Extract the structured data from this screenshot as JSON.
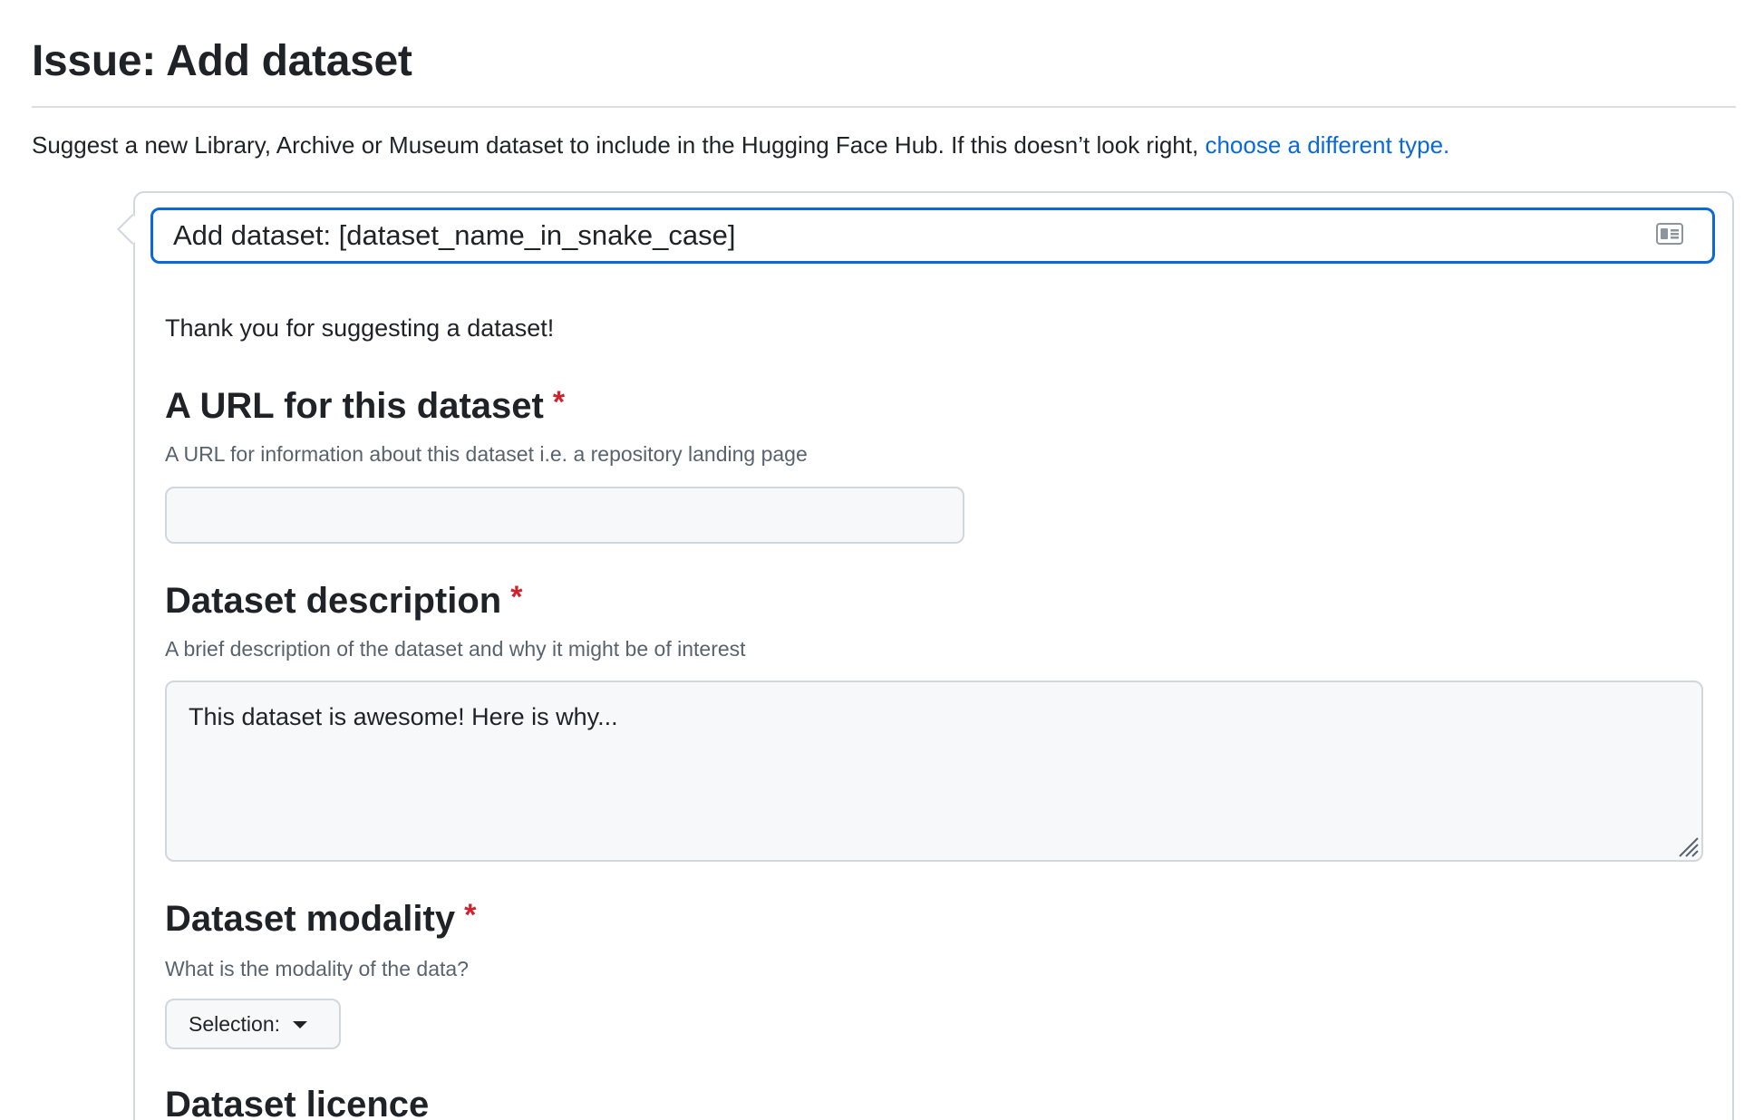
{
  "page": {
    "title": "Issue: Add dataset",
    "intro_text": "Suggest a new Library, Archive or Museum dataset to include in the Hugging Face Hub. If this doesn’t look right, ",
    "intro_link": "choose a different type."
  },
  "form": {
    "title_value": "Add dataset: [dataset_name_in_snake_case]",
    "title_icon": "id-card-icon",
    "thanks": "Thank you for suggesting a dataset!",
    "required_marker": "*",
    "fields": {
      "url": {
        "label": "A URL for this dataset",
        "help": "A URL for information about this dataset i.e. a repository landing page",
        "value": ""
      },
      "description": {
        "label": "Dataset description",
        "help": "A brief description of the dataset and why it might be of interest",
        "value": "This dataset is awesome! Here is why..."
      },
      "modality": {
        "label": "Dataset modality",
        "help": "What is the modality of the data?",
        "select_label": "Selection:"
      },
      "licence": {
        "label": "Dataset licence"
      }
    }
  },
  "colors": {
    "accent": "#0969da",
    "required": "#cf222e",
    "input_bg": "#f6f8fa",
    "border": "#d0d7de"
  }
}
